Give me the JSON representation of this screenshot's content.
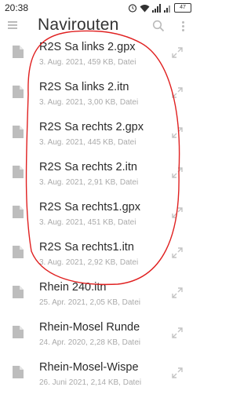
{
  "status_bar": {
    "time": "20:38",
    "battery": "47"
  },
  "app_bar": {
    "title": "Navirouten"
  },
  "files": [
    {
      "name": "R2S Sa links 2.gpx",
      "meta": "3. Aug. 2021, 459 KB, Datei"
    },
    {
      "name": "R2S Sa links 2.itn",
      "meta": "3. Aug. 2021, 3,00 KB, Datei"
    },
    {
      "name": "R2S Sa rechts 2.gpx",
      "meta": "3. Aug. 2021, 445 KB, Datei"
    },
    {
      "name": "R2S Sa rechts 2.itn",
      "meta": "3. Aug. 2021, 2,91 KB, Datei"
    },
    {
      "name": "R2S Sa rechts1.gpx",
      "meta": "3. Aug. 2021, 451 KB, Datei"
    },
    {
      "name": "R2S Sa rechts1.itn",
      "meta": "3. Aug. 2021, 2,92 KB, Datei"
    },
    {
      "name": "Rhein 240.itn",
      "meta": "25. Apr. 2021, 2,05 KB, Datei"
    },
    {
      "name": "Rhein-Mosel Runde",
      "meta": "24. Apr. 2020, 2,28 KB, Datei"
    },
    {
      "name": "Rhein-Mosel-Wispe",
      "meta": "26. Juni 2021, 2,14 KB, Datei"
    }
  ],
  "colors": {
    "annotation": "#e02020",
    "icon": "#bdbdbd"
  }
}
